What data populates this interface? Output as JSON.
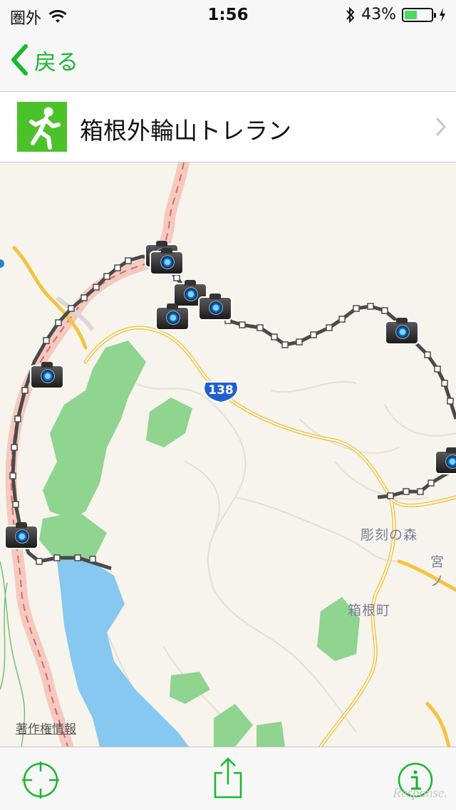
{
  "status_bar": {
    "carrier": "圏外",
    "time": "1:56",
    "battery_percent": "43%",
    "battery_level": 0.43,
    "icons": [
      "wifi-icon",
      "bluetooth-icon",
      "charging-bolt-icon"
    ]
  },
  "nav": {
    "back_label": "戻る",
    "accent_color": "#19b82c"
  },
  "route": {
    "title": "箱根外輪山トレラン",
    "activity_icon": "running-person-icon",
    "icon_color": "#4cc22a"
  },
  "map": {
    "road_shield": "138",
    "place_labels": {
      "sculpture_forest": "彫刻の森",
      "miyanoshita": "宮ノ",
      "hakone_town": "箱根町"
    },
    "legal": "著作権情報",
    "photo_markers": 9,
    "colors": {
      "land": "#f6f4ec",
      "park": "#8fd48f",
      "water": "#86c8ef",
      "highway": "#f5c242",
      "track": "#4a4a4a"
    }
  },
  "toolbar": {
    "icons": [
      "locate-crosshair-icon",
      "share-icon",
      "info-icon"
    ]
  },
  "watermark": "Response."
}
